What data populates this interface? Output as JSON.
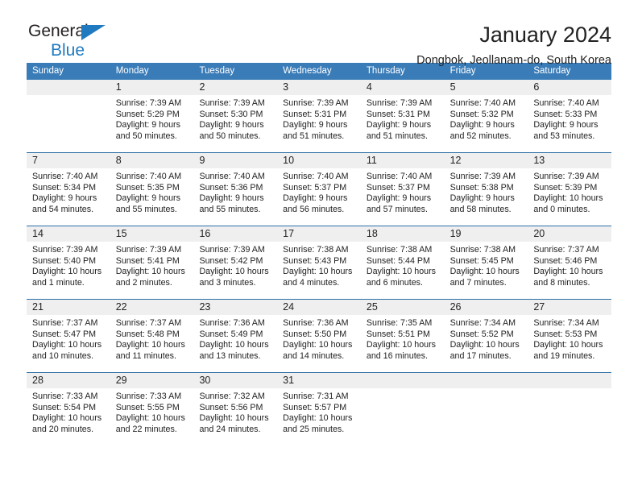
{
  "brand": {
    "name_part1": "General",
    "name_part2": "Blue",
    "triangle_icon": "triangle-icon",
    "accent_color": "#1f7ac0"
  },
  "header": {
    "title": "January 2024",
    "subtitle": "Dongbok, Jeollanam-do, South Korea"
  },
  "calendar": {
    "header_bg": "#3a7cb8",
    "daynum_bg": "#efefef",
    "divider_color": "#2f6ea5",
    "weekdays": [
      "Sunday",
      "Monday",
      "Tuesday",
      "Wednesday",
      "Thursday",
      "Friday",
      "Saturday"
    ],
    "weeks": [
      [
        {
          "day": "",
          "lines": []
        },
        {
          "day": "1",
          "lines": [
            "Sunrise: 7:39 AM",
            "Sunset: 5:29 PM",
            "Daylight: 9 hours",
            "and 50 minutes."
          ]
        },
        {
          "day": "2",
          "lines": [
            "Sunrise: 7:39 AM",
            "Sunset: 5:30 PM",
            "Daylight: 9 hours",
            "and 50 minutes."
          ]
        },
        {
          "day": "3",
          "lines": [
            "Sunrise: 7:39 AM",
            "Sunset: 5:31 PM",
            "Daylight: 9 hours",
            "and 51 minutes."
          ]
        },
        {
          "day": "4",
          "lines": [
            "Sunrise: 7:39 AM",
            "Sunset: 5:31 PM",
            "Daylight: 9 hours",
            "and 51 minutes."
          ]
        },
        {
          "day": "5",
          "lines": [
            "Sunrise: 7:40 AM",
            "Sunset: 5:32 PM",
            "Daylight: 9 hours",
            "and 52 minutes."
          ]
        },
        {
          "day": "6",
          "lines": [
            "Sunrise: 7:40 AM",
            "Sunset: 5:33 PM",
            "Daylight: 9 hours",
            "and 53 minutes."
          ]
        }
      ],
      [
        {
          "day": "7",
          "lines": [
            "Sunrise: 7:40 AM",
            "Sunset: 5:34 PM",
            "Daylight: 9 hours",
            "and 54 minutes."
          ]
        },
        {
          "day": "8",
          "lines": [
            "Sunrise: 7:40 AM",
            "Sunset: 5:35 PM",
            "Daylight: 9 hours",
            "and 55 minutes."
          ]
        },
        {
          "day": "9",
          "lines": [
            "Sunrise: 7:40 AM",
            "Sunset: 5:36 PM",
            "Daylight: 9 hours",
            "and 55 minutes."
          ]
        },
        {
          "day": "10",
          "lines": [
            "Sunrise: 7:40 AM",
            "Sunset: 5:37 PM",
            "Daylight: 9 hours",
            "and 56 minutes."
          ]
        },
        {
          "day": "11",
          "lines": [
            "Sunrise: 7:40 AM",
            "Sunset: 5:37 PM",
            "Daylight: 9 hours",
            "and 57 minutes."
          ]
        },
        {
          "day": "12",
          "lines": [
            "Sunrise: 7:39 AM",
            "Sunset: 5:38 PM",
            "Daylight: 9 hours",
            "and 58 minutes."
          ]
        },
        {
          "day": "13",
          "lines": [
            "Sunrise: 7:39 AM",
            "Sunset: 5:39 PM",
            "Daylight: 10 hours",
            "and 0 minutes."
          ]
        }
      ],
      [
        {
          "day": "14",
          "lines": [
            "Sunrise: 7:39 AM",
            "Sunset: 5:40 PM",
            "Daylight: 10 hours",
            "and 1 minute."
          ]
        },
        {
          "day": "15",
          "lines": [
            "Sunrise: 7:39 AM",
            "Sunset: 5:41 PM",
            "Daylight: 10 hours",
            "and 2 minutes."
          ]
        },
        {
          "day": "16",
          "lines": [
            "Sunrise: 7:39 AM",
            "Sunset: 5:42 PM",
            "Daylight: 10 hours",
            "and 3 minutes."
          ]
        },
        {
          "day": "17",
          "lines": [
            "Sunrise: 7:38 AM",
            "Sunset: 5:43 PM",
            "Daylight: 10 hours",
            "and 4 minutes."
          ]
        },
        {
          "day": "18",
          "lines": [
            "Sunrise: 7:38 AM",
            "Sunset: 5:44 PM",
            "Daylight: 10 hours",
            "and 6 minutes."
          ]
        },
        {
          "day": "19",
          "lines": [
            "Sunrise: 7:38 AM",
            "Sunset: 5:45 PM",
            "Daylight: 10 hours",
            "and 7 minutes."
          ]
        },
        {
          "day": "20",
          "lines": [
            "Sunrise: 7:37 AM",
            "Sunset: 5:46 PM",
            "Daylight: 10 hours",
            "and 8 minutes."
          ]
        }
      ],
      [
        {
          "day": "21",
          "lines": [
            "Sunrise: 7:37 AM",
            "Sunset: 5:47 PM",
            "Daylight: 10 hours",
            "and 10 minutes."
          ]
        },
        {
          "day": "22",
          "lines": [
            "Sunrise: 7:37 AM",
            "Sunset: 5:48 PM",
            "Daylight: 10 hours",
            "and 11 minutes."
          ]
        },
        {
          "day": "23",
          "lines": [
            "Sunrise: 7:36 AM",
            "Sunset: 5:49 PM",
            "Daylight: 10 hours",
            "and 13 minutes."
          ]
        },
        {
          "day": "24",
          "lines": [
            "Sunrise: 7:36 AM",
            "Sunset: 5:50 PM",
            "Daylight: 10 hours",
            "and 14 minutes."
          ]
        },
        {
          "day": "25",
          "lines": [
            "Sunrise: 7:35 AM",
            "Sunset: 5:51 PM",
            "Daylight: 10 hours",
            "and 16 minutes."
          ]
        },
        {
          "day": "26",
          "lines": [
            "Sunrise: 7:34 AM",
            "Sunset: 5:52 PM",
            "Daylight: 10 hours",
            "and 17 minutes."
          ]
        },
        {
          "day": "27",
          "lines": [
            "Sunrise: 7:34 AM",
            "Sunset: 5:53 PM",
            "Daylight: 10 hours",
            "and 19 minutes."
          ]
        }
      ],
      [
        {
          "day": "28",
          "lines": [
            "Sunrise: 7:33 AM",
            "Sunset: 5:54 PM",
            "Daylight: 10 hours",
            "and 20 minutes."
          ]
        },
        {
          "day": "29",
          "lines": [
            "Sunrise: 7:33 AM",
            "Sunset: 5:55 PM",
            "Daylight: 10 hours",
            "and 22 minutes."
          ]
        },
        {
          "day": "30",
          "lines": [
            "Sunrise: 7:32 AM",
            "Sunset: 5:56 PM",
            "Daylight: 10 hours",
            "and 24 minutes."
          ]
        },
        {
          "day": "31",
          "lines": [
            "Sunrise: 7:31 AM",
            "Sunset: 5:57 PM",
            "Daylight: 10 hours",
            "and 25 minutes."
          ]
        },
        {
          "day": "",
          "lines": []
        },
        {
          "day": "",
          "lines": []
        },
        {
          "day": "",
          "lines": []
        }
      ]
    ]
  }
}
